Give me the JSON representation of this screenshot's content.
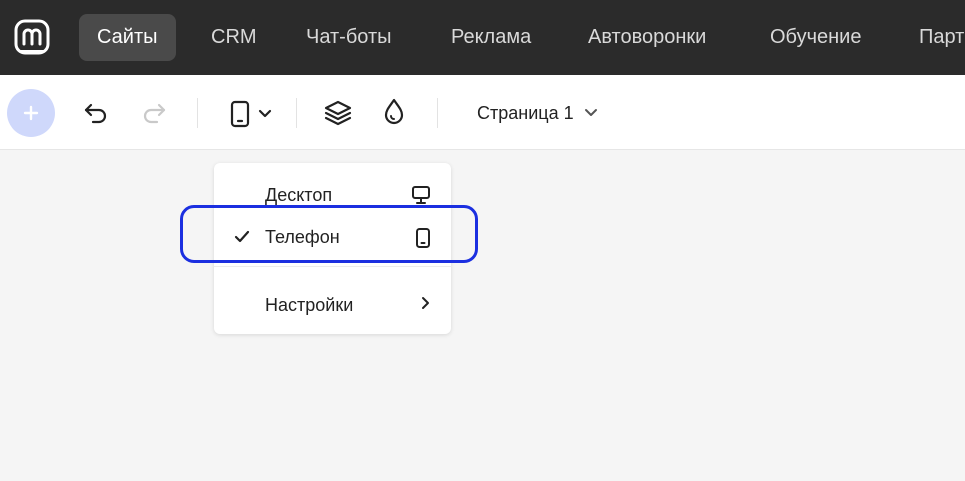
{
  "nav": {
    "items": [
      {
        "label": "Сайты",
        "active": true
      },
      {
        "label": "CRM"
      },
      {
        "label": "Чат-боты"
      },
      {
        "label": "Реклама"
      },
      {
        "label": "Автоворонки"
      },
      {
        "label": "Обучение"
      },
      {
        "label": "Партнерам"
      }
    ]
  },
  "toolbar": {
    "page_select": "Страница 1"
  },
  "device_menu": {
    "desktop": "Десктоп",
    "phone": "Телефон",
    "settings": "Настройки",
    "selected": "phone"
  },
  "colors": {
    "nav_bg": "#2b2b2b",
    "add_button": "#cfd8fb",
    "highlight": "#1b2fe0"
  }
}
